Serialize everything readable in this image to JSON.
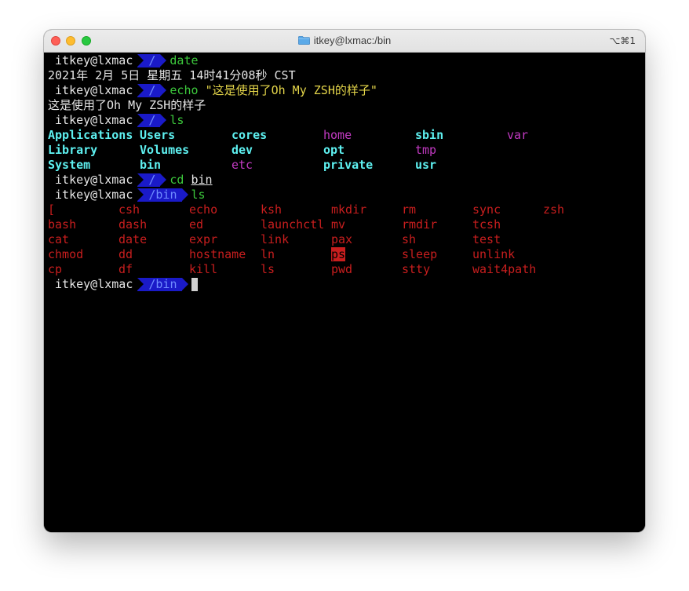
{
  "window": {
    "title": "itkey@lxmac:/bin",
    "shortcut": "⌥⌘1",
    "folder_icon": "folder-icon"
  },
  "colors": {
    "prompt_segment_bg": "#1a1ac8",
    "command_green": "#3cc83c",
    "dir_cyan": "#5ef1f1",
    "link_magenta": "#c23ac2",
    "exec_red": "#c81e1e",
    "string_yellow": "#e5d64a"
  },
  "terminal": {
    "prompt_user": "itkey@lxmac",
    "session": [
      {
        "type": "prompt",
        "path": "/",
        "cmd": "date",
        "arg": ""
      },
      {
        "type": "output",
        "text": "2021年 2月 5日 星期五 14时41分08秒 CST"
      },
      {
        "type": "prompt",
        "path": "/",
        "cmd": "echo",
        "arg": "\"这是使用了Oh My ZSH的样子\""
      },
      {
        "type": "output",
        "text": "这是使用了Oh My ZSH的样子"
      },
      {
        "type": "prompt",
        "path": "/",
        "cmd": "ls",
        "arg": ""
      }
    ],
    "root_listing": [
      [
        {
          "name": "Applications",
          "kind": "dir"
        },
        {
          "name": "Users",
          "kind": "dir"
        },
        {
          "name": "cores",
          "kind": "dir"
        },
        {
          "name": "home",
          "kind": "link"
        },
        {
          "name": "sbin",
          "kind": "dir"
        },
        {
          "name": "var",
          "kind": "link"
        }
      ],
      [
        {
          "name": "Library",
          "kind": "dir"
        },
        {
          "name": "Volumes",
          "kind": "dir"
        },
        {
          "name": "dev",
          "kind": "dir"
        },
        {
          "name": "opt",
          "kind": "dir"
        },
        {
          "name": "tmp",
          "kind": "link"
        }
      ],
      [
        {
          "name": "System",
          "kind": "dir"
        },
        {
          "name": "bin",
          "kind": "dir"
        },
        {
          "name": "etc",
          "kind": "link"
        },
        {
          "name": "private",
          "kind": "dir"
        },
        {
          "name": "usr",
          "kind": "dir"
        }
      ]
    ],
    "cd_prompt": {
      "path": "/",
      "cmd": "cd",
      "arg": "bin"
    },
    "ls_prompt": {
      "path": "/bin",
      "cmd": "ls"
    },
    "bin_listing": [
      [
        "[",
        "csh",
        "echo",
        "ksh",
        "mkdir",
        "rm",
        "sync",
        "zsh"
      ],
      [
        "bash",
        "dash",
        "ed",
        "launchctl",
        "mv",
        "rmdir",
        "tcsh"
      ],
      [
        "cat",
        "date",
        "expr",
        "link",
        "pax",
        "sh",
        "test"
      ],
      [
        "chmod",
        "dd",
        "hostname",
        "ln",
        "ps",
        "sleep",
        "unlink"
      ],
      [
        "cp",
        "df",
        "kill",
        "ls",
        "pwd",
        "stty",
        "wait4path"
      ]
    ],
    "highlighted_entry": "ps",
    "final_prompt": {
      "path": "/bin"
    }
  }
}
